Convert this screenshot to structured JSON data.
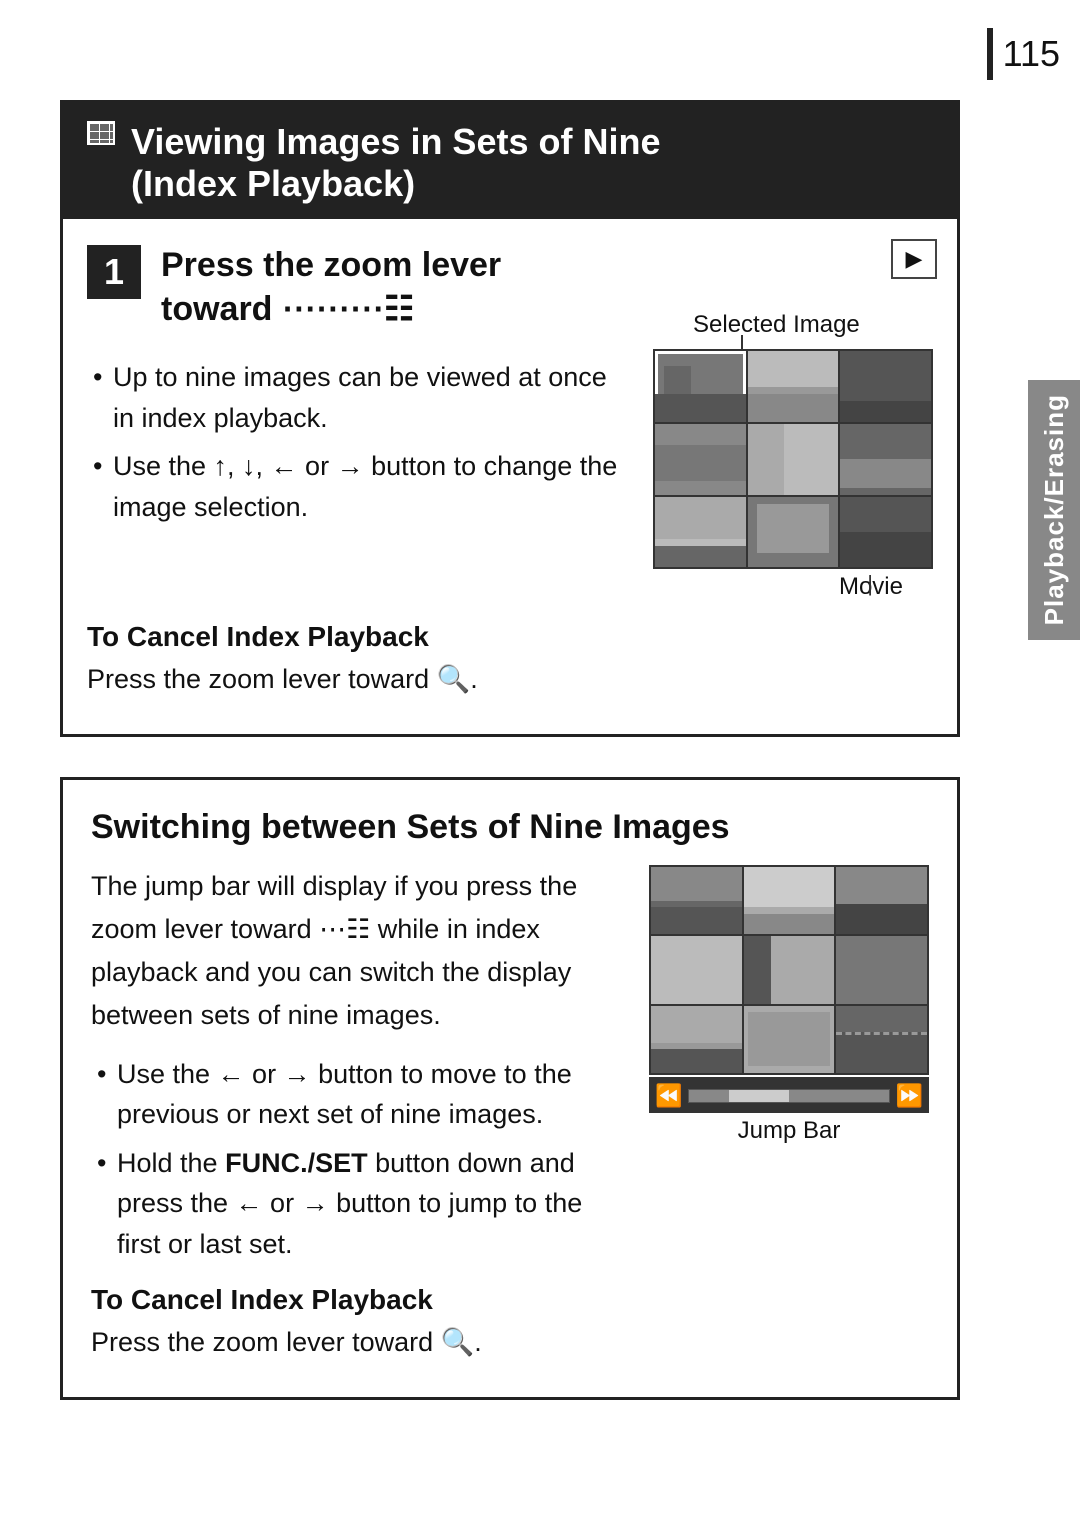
{
  "page": {
    "number": "115"
  },
  "side_tab": {
    "text": "Playback/Erasing"
  },
  "section1": {
    "title_line1": "Viewing Images in Sets of Nine",
    "title_line2": "(Index Playback)",
    "step_number": "1",
    "step_title_line1": "Press the zoom lever",
    "step_title_line2": "toward ⋯.",
    "bullet1": "Up to nine images can be viewed at once in index playback.",
    "bullet2_pre": "Use the ↑, ↓, ← or → button to change the image selection.",
    "selected_image_label": "Selected Image",
    "movie_label": "Movie",
    "cancel_title": "To Cancel Index Playback",
    "cancel_text": "Press the zoom lever toward 🔍."
  },
  "section2": {
    "title": "Switching between Sets of Nine Images",
    "body": "The jump bar will display if you press the zoom lever toward ⋯ while in index playback and you can switch the display between sets of nine images.",
    "bullet1": "Use the ← or → button to move to the previous or next set of nine images.",
    "bullet2_pre": "Hold the",
    "bullet2_bold": "FUNC./SET",
    "bullet2_post": "button down and press the ← or → button to jump to the first or last set.",
    "jump_bar_label": "Jump Bar",
    "cancel_title": "To Cancel Index Playback",
    "cancel_text": "Press the zoom lever toward 🔍."
  }
}
